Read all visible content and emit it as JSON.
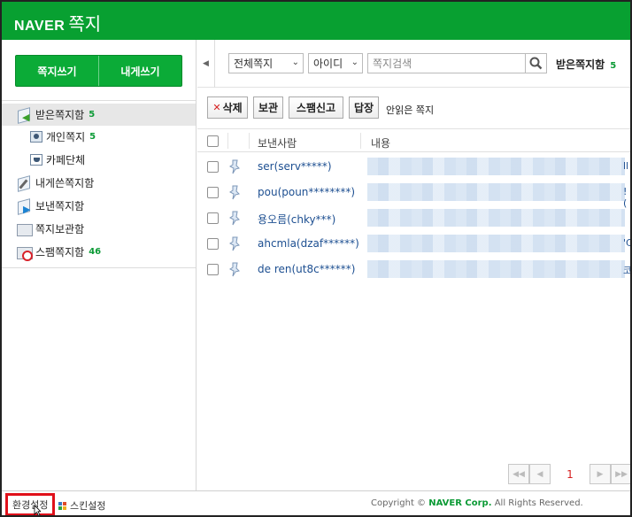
{
  "app": {
    "brand": "NAVER",
    "title": "쪽지"
  },
  "sidebar": {
    "write_buttons": [
      {
        "label": "쪽지쓰기"
      },
      {
        "label": "내게쓰기"
      }
    ],
    "folders": [
      {
        "label": "받은쪽지함",
        "count": "5",
        "icon": "inbox-icon",
        "selected": true
      },
      {
        "label": "개인쪽지",
        "count": "5",
        "icon": "person-icon"
      },
      {
        "label": "카페단체",
        "count": "",
        "icon": "cafe-icon"
      },
      {
        "label": "내게쓴쪽지함",
        "count": "",
        "icon": "self-note-icon"
      },
      {
        "label": "보낸쪽지함",
        "count": "",
        "icon": "outbox-icon"
      },
      {
        "label": "쪽지보관함",
        "count": "",
        "icon": "folder-icon"
      },
      {
        "label": "스팸쪽지함",
        "count": "46",
        "icon": "spam-folder-icon"
      }
    ]
  },
  "toolbar": {
    "scope_select": "전체쪽지",
    "field_select": "아이디",
    "search_placeholder": "쪽지검색",
    "mailbox_title": "받은쪽지함",
    "mailbox_count": "5",
    "delete_label": "삭제",
    "archive_label": "보관",
    "spam_label": "스팸신고",
    "reply_label": "답장",
    "unread_label": "안읽은 쪽지"
  },
  "table": {
    "columns": [
      "보낸사람",
      "내용"
    ],
    "rows": [
      {
        "sender": "ser(serv*****)",
        "tail": "ll"
      },
      {
        "sender": "pou(poun********)",
        "tail": "!("
      },
      {
        "sender": "용오름(chky***)",
        "tail": ""
      },
      {
        "sender": "ahcmla(dzaf******)",
        "tail": "'C"
      },
      {
        "sender": "de ren(ut8c******)",
        "tail": "코"
      }
    ]
  },
  "pagination": {
    "current_page": "1"
  },
  "footer": {
    "settings_label": "환경설정",
    "skin_label": "스킨설정",
    "copyright_prefix": "Copyright ©",
    "copyright_company": "NAVER Corp.",
    "copyright_suffix": "All Rights Reserved."
  },
  "colors": {
    "brand_green": "#08a031",
    "count_green": "#0b9a35",
    "highlight_red": "#e0101a"
  }
}
